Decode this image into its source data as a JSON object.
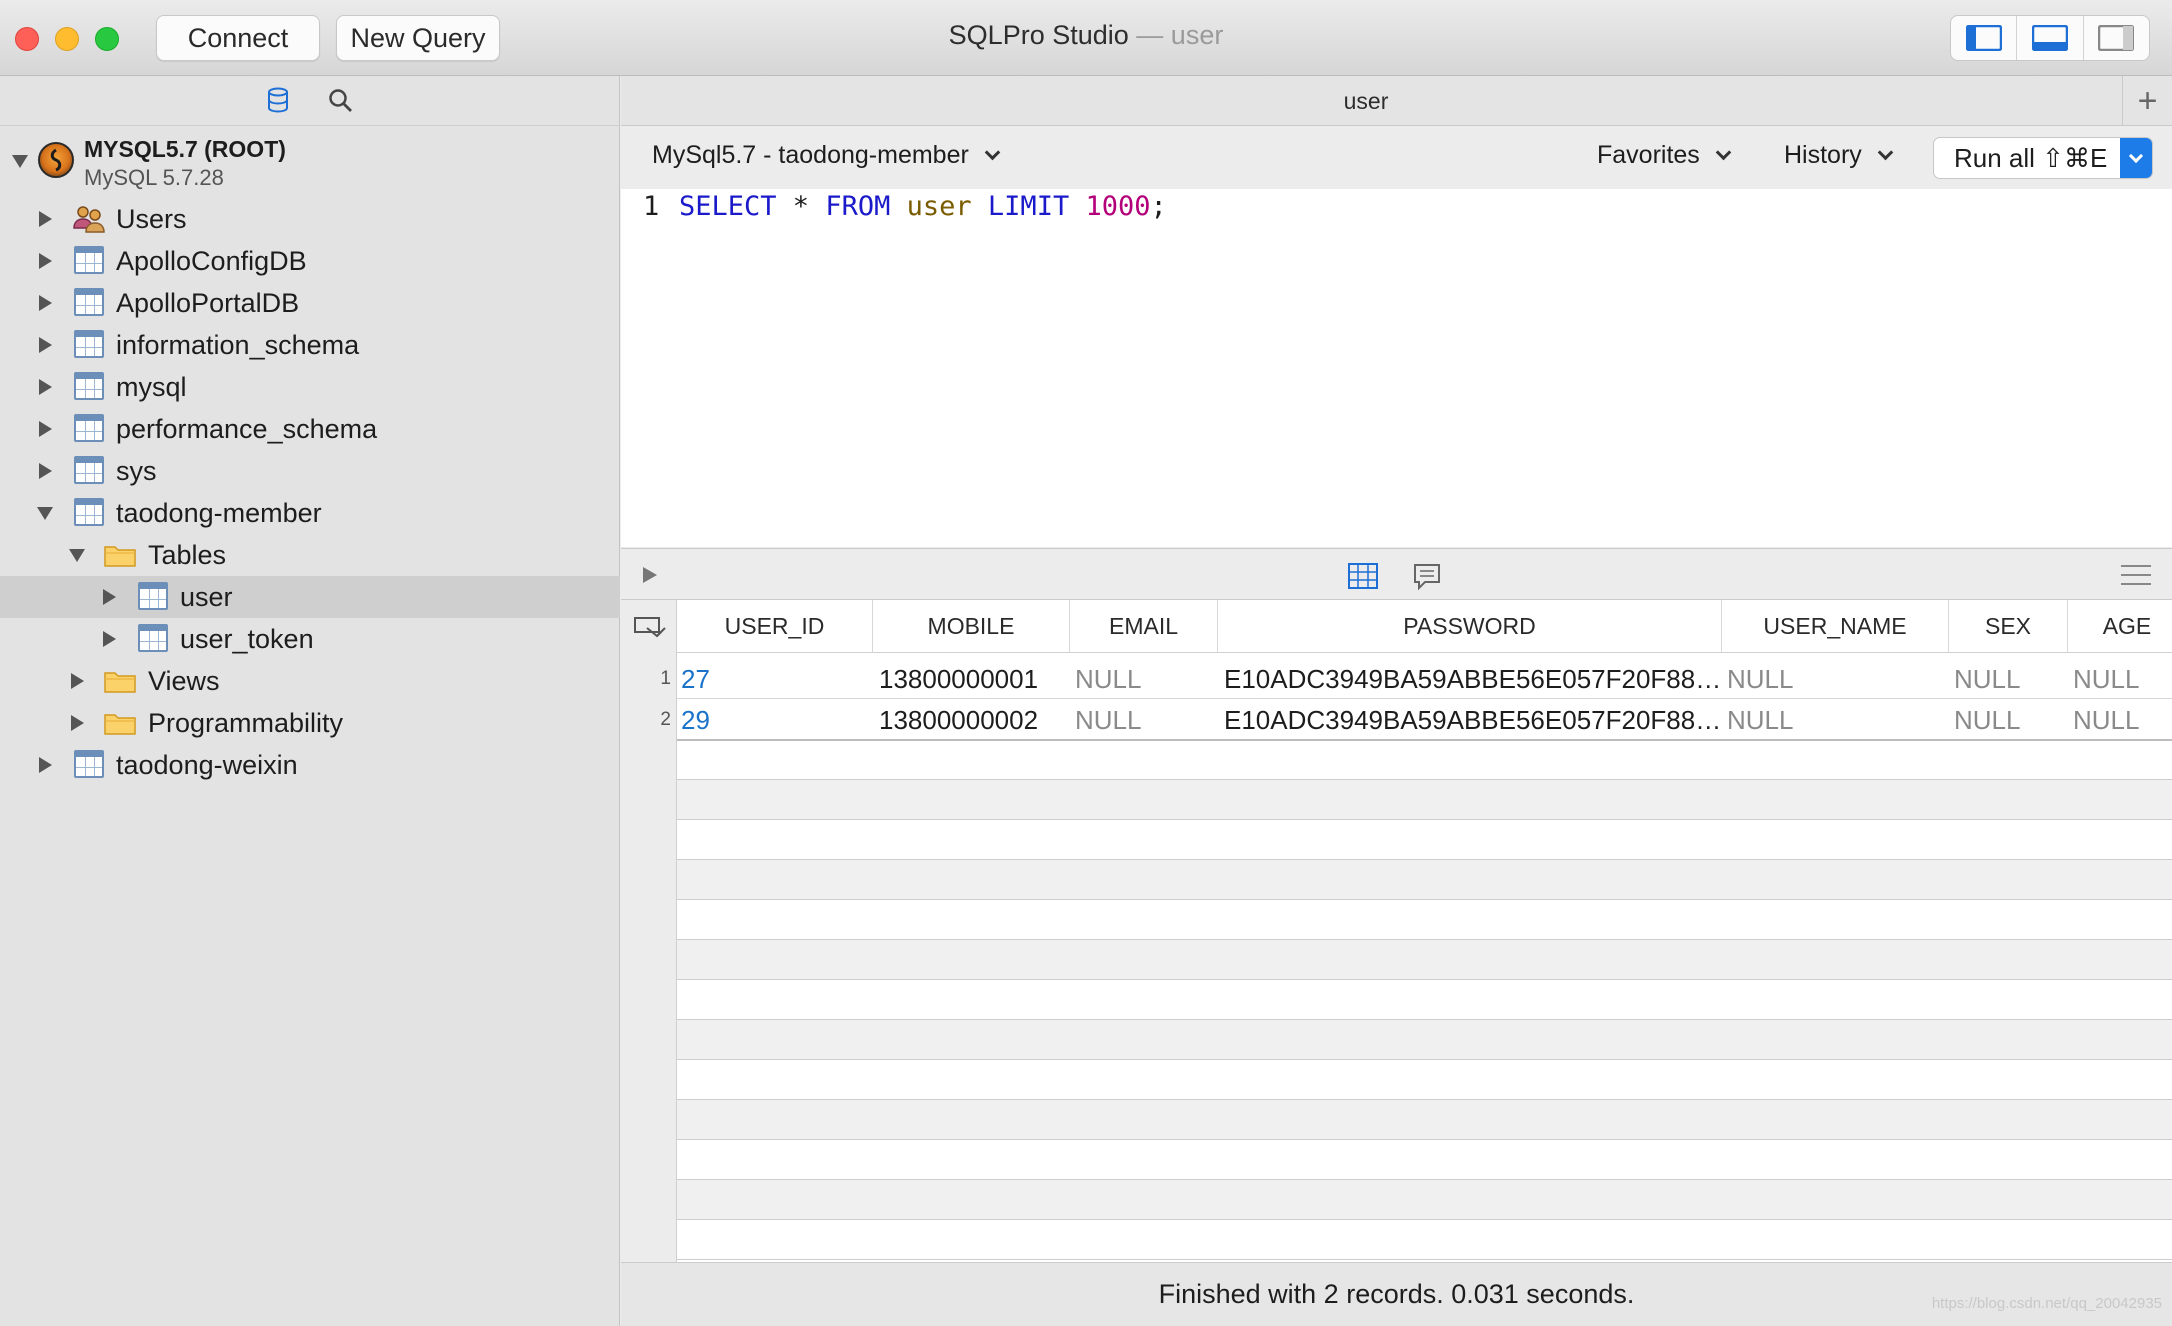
{
  "window": {
    "app_title": "SQLPro Studio",
    "title_separator": " — ",
    "document_name": "user",
    "connect_label": "Connect",
    "new_query_label": "New Query"
  },
  "sidebar": {
    "connection": {
      "name": "MYSQL5.7 (ROOT)",
      "version": "MySQL 5.7.28"
    },
    "items": [
      {
        "label": "Users"
      },
      {
        "label": "ApolloConfigDB"
      },
      {
        "label": "ApolloPortalDB"
      },
      {
        "label": "information_schema"
      },
      {
        "label": "mysql"
      },
      {
        "label": "performance_schema"
      },
      {
        "label": "sys"
      },
      {
        "label": "taodong-member"
      },
      {
        "label": "Tables"
      },
      {
        "label": "user"
      },
      {
        "label": "user_token"
      },
      {
        "label": "Views"
      },
      {
        "label": "Programmability"
      },
      {
        "label": "taodong-weixin"
      }
    ]
  },
  "tab": {
    "title": "user",
    "add_label": "+"
  },
  "querybar": {
    "database": "MySql5.7 - taodong-member",
    "favorites": "Favorites",
    "history": "History",
    "run_all": "Run all ⇧⌘E"
  },
  "editor": {
    "line_number": "1",
    "tokens": {
      "select": "SELECT",
      "star": " * ",
      "from": "FROM",
      "table": "user",
      "limit": "LIMIT",
      "count": "1000",
      "semi": ";"
    }
  },
  "results": {
    "columns": [
      "USER_ID",
      "MOBILE",
      "EMAIL",
      "PASSWORD",
      "USER_NAME",
      "SEX",
      "AGE"
    ],
    "rows": [
      {
        "num": "1",
        "user_id": "27",
        "mobile": "13800000001",
        "email": "NULL",
        "password": "E10ADC3949BA59ABBE56E057F20F88…",
        "user_name": "NULL",
        "sex": "NULL",
        "age": "NULL"
      },
      {
        "num": "2",
        "user_id": "29",
        "mobile": "13800000002",
        "email": "NULL",
        "password": "E10ADC3949BA59ABBE56E057F20F88…",
        "user_name": "NULL",
        "sex": "NULL",
        "age": "NULL"
      }
    ]
  },
  "status": {
    "message": "Finished with 2 records. 0.031 seconds.",
    "watermark": "https://blog.csdn.net/qq_20042935"
  },
  "colors": {
    "accent": "#1d7ce8",
    "link": "#1a73c9",
    "keyword": "#1a1acb",
    "number": "#b3007a",
    "identifier": "#7a5c00"
  }
}
